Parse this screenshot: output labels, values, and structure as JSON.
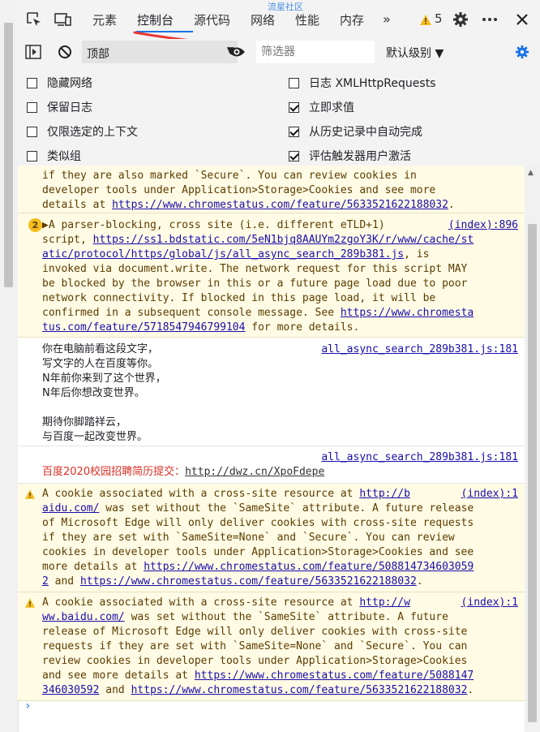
{
  "tabs": {
    "items": [
      "元素",
      "控制台",
      "源代码",
      "网络",
      "性能",
      "内存"
    ],
    "more": "»",
    "warning_count": "5"
  },
  "watermark": "流星社区",
  "toolbar": {
    "context": "顶部",
    "filter_placeholder": "筛选器",
    "level": "默认级别 ▼"
  },
  "settings": [
    {
      "label": "隐藏网络",
      "checked": false
    },
    {
      "label": "日志 XMLHttpRequests",
      "checked": false
    },
    {
      "label": "保留日志",
      "checked": false
    },
    {
      "label": "立即求值",
      "checked": true
    },
    {
      "label": "仅限选定的上下文",
      "checked": false
    },
    {
      "label": "从历史记录中自动完成",
      "checked": true
    },
    {
      "label": "类似组",
      "checked": false
    },
    {
      "label": "评估触发器用户激活",
      "checked": true
    }
  ],
  "messages": {
    "m1": {
      "line1": "if they are also marked `Secure`. You can review cookies in",
      "line2": "developer tools under Application>Storage>Cookies and see more",
      "line3_text": "details at ",
      "line3_link": "https://www.chromestatus.com/feature/5633521622188032",
      "line3_end": "."
    },
    "m2": {
      "count": "2",
      "line1": "A parser-blocking, cross site (i.e. different eTLD+1)",
      "source": "(index):896",
      "line2_text": "script, ",
      "line2_link": "https://ss1.bdstatic.com/5eN1bjq8AAUYm2zgoY3K/r/www/cache/st",
      "line3_link": "atic/protocol/https/global/js/all_async_search_289b381.js",
      "line3_text": ", is",
      "line4": "invoked via document.write. The network request for this script MAY",
      "line5": "be blocked by the browser in this or a future page load due to poor",
      "line6": "network connectivity. If blocked in this page load, it will be",
      "line7_text": "confirmed in a subsequent console message. See ",
      "line7_link": "https://www.chromesta",
      "line8_link": "tus.com/feature/5718547946799104",
      "line8_text": " for more details."
    },
    "m3": {
      "source": "all_async_search_289b381.js:181",
      "lines": [
        "你在电脑前看这段文字，",
        "写文字的人在百度等你。",
        "N年前你来到了这个世界，",
        "N年后你想改变世界。",
        "",
        "期待你脚踏祥云，",
        "与百度一起改变世界。"
      ]
    },
    "m4": {
      "source": "all_async_search_289b381.js:181",
      "red_text": "百度2020校园招聘简历提交：",
      "url": "http://dwz.cn/XpoFdepe"
    },
    "m5": {
      "line1_text": "A cookie associated with a cross-site resource at ",
      "line1_link": "http://b",
      "source": "(index):1",
      "line2_link": "aidu.com/",
      "line2_text": " was set without the `SameSite` attribute. A future release",
      "line3": "of Microsoft Edge will only deliver cookies with cross-site requests",
      "line4": "if they are set with `SameSite=None` and `Secure`. You can review",
      "line5": "cookies in developer tools under Application>Storage>Cookies and see",
      "line6_text": "more details at ",
      "line6_link": "https://www.chromestatus.com/feature/508814734603059",
      "line7_link": "2",
      "line7_text": " and ",
      "line7_link2": "https://www.chromestatus.com/feature/5633521622188032",
      "line7_end": "."
    },
    "m6": {
      "line1_text": "A cookie associated with a cross-site resource at ",
      "line1_link": "http://w",
      "source": "(index):1",
      "line2_link": "ww.baidu.com/",
      "line2_text": " was set without the `SameSite` attribute. A future",
      "line3": "release of Microsoft Edge will only deliver cookies with cross-site",
      "line4": "requests if they are set with `SameSite=None` and `Secure`. You can",
      "line5": "review cookies in developer tools under Application>Storage>Cookies",
      "line6_text": "and see more details at ",
      "line6_link": "https://www.chromestatus.com/feature/5088147",
      "line7_link": "346030592",
      "line7_text": " and ",
      "line7_link2": "https://www.chromestatus.com/feature/5633521622188032",
      "line7_end": "."
    }
  },
  "prompt": "›",
  "colors": {
    "accent": "#1a73e8",
    "warning_bg": "#fffbe5",
    "warning_text": "#5c3c00",
    "red": "#d93025"
  }
}
